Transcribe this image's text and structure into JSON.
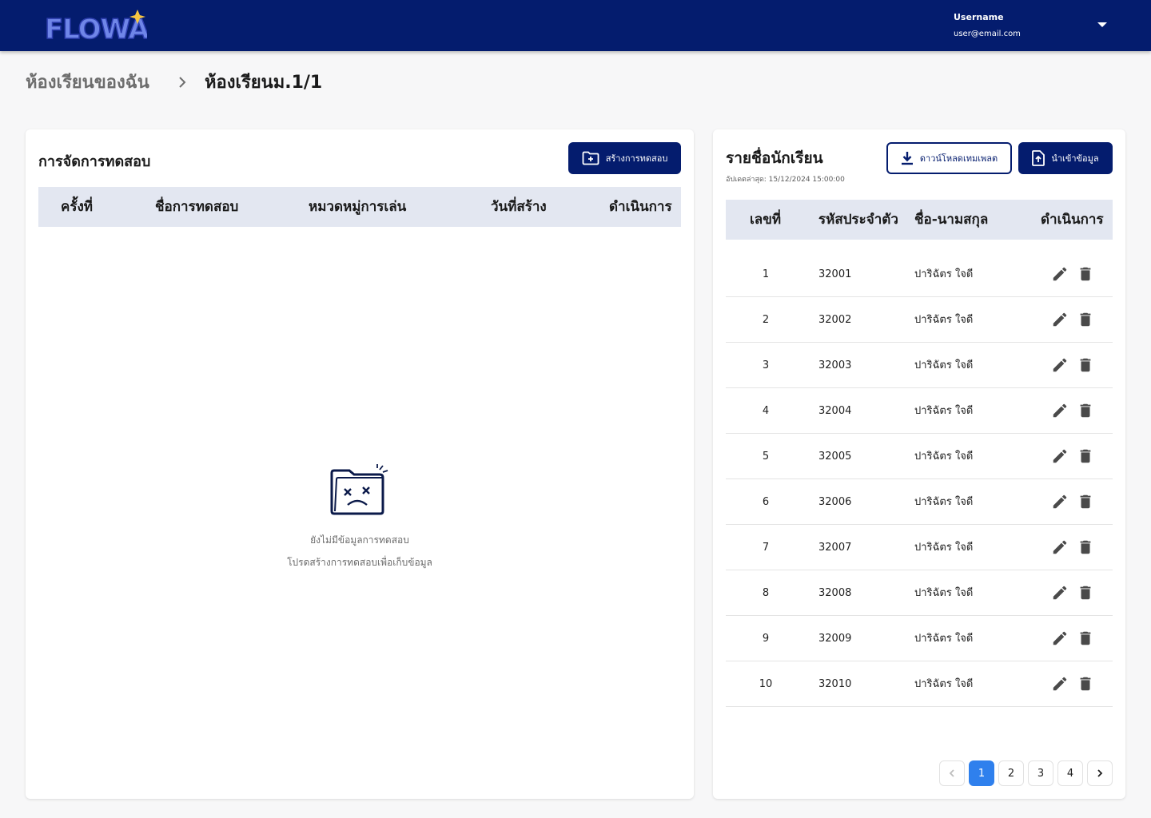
{
  "header": {
    "logo_text": "FLOWA",
    "user_name": "Username",
    "user_email": "user@email.com"
  },
  "breadcrumb": {
    "parent": "ห้องเรียนของฉัน",
    "current": "ห้องเรียนม.1/1"
  },
  "tests": {
    "title": "การจัดการทดสอบ",
    "create_button": "สร้างการทดสอบ",
    "columns": [
      "ครั้งที่",
      "ชื่อการทดสอบ",
      "หมวดหมู่การเล่น",
      "วันที่สร้าง",
      "ดำเนินการ"
    ],
    "empty_line1": "ยังไม่มีข้อมูลการทดสอบ",
    "empty_line2": "โปรดสร้างการทดสอบเพื่อเก็บข้อมูล"
  },
  "students": {
    "title": "รายชื่อนักเรียน",
    "updated": "อัปเดตล่าสุด: 15/12/2024 15:00:00",
    "download_button": "ดาวน์โหลดเทมเพลต",
    "import_button": "นำเข้าข้อมูล",
    "columns": [
      "เลขที่",
      "รหัสประจำตัว",
      "ชื่อ-นามสกุล",
      "ดำเนินการ"
    ],
    "rows": [
      {
        "no": "1",
        "id": "32001",
        "name": "ปาริฉัตร ใจดี"
      },
      {
        "no": "2",
        "id": "32002",
        "name": "ปาริฉัตร ใจดี"
      },
      {
        "no": "3",
        "id": "32003",
        "name": "ปาริฉัตร ใจดี"
      },
      {
        "no": "4",
        "id": "32004",
        "name": "ปาริฉัตร ใจดี"
      },
      {
        "no": "5",
        "id": "32005",
        "name": "ปาริฉัตร ใจดี"
      },
      {
        "no": "6",
        "id": "32006",
        "name": "ปาริฉัตร ใจดี"
      },
      {
        "no": "7",
        "id": "32007",
        "name": "ปาริฉัตร ใจดี"
      },
      {
        "no": "8",
        "id": "32008",
        "name": "ปาริฉัตร ใจดี"
      },
      {
        "no": "9",
        "id": "32009",
        "name": "ปาริฉัตร ใจดี"
      },
      {
        "no": "10",
        "id": "32010",
        "name": "ปาริฉัตร ใจดี"
      }
    ],
    "pages": [
      "1",
      "2",
      "3",
      "4"
    ],
    "current_page": "1"
  },
  "colors": {
    "primary": "#041c6e",
    "accent": "#2f80ed",
    "table_header": "#e3e7f1"
  }
}
